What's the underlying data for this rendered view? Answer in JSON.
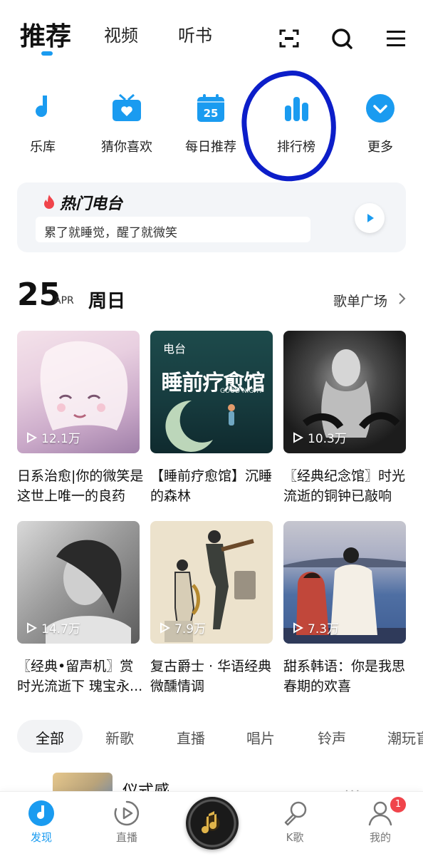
{
  "top_tabs": [
    "推荐",
    "视频",
    "听书"
  ],
  "quick_nav": [
    {
      "label": "乐库",
      "icon": "music-note-icon"
    },
    {
      "label": "猜你喜欢",
      "icon": "heart-radio-icon"
    },
    {
      "label": "每日推荐",
      "icon": "calendar-icon",
      "icon_text": "25"
    },
    {
      "label": "排行榜",
      "icon": "bar-chart-icon"
    },
    {
      "label": "更多",
      "icon": "chevron-down-icon"
    }
  ],
  "radio": {
    "title": "热门电台",
    "subtitle": "累了就睡觉，醒了就微笑"
  },
  "date": {
    "day": "25",
    "month": "APR",
    "weekday": "周日"
  },
  "playlist_link": "歌单广场",
  "cards": [
    {
      "plays": "12.1万",
      "title": "日系治愈|你的微笑是这世上唯一的良药"
    },
    {
      "plays": "",
      "badge": "电台",
      "cover_text": "睡前疗愈馆",
      "cover_sub": "GOOD NIGHT",
      "title": "【睡前疗愈馆】沉睡的森林"
    },
    {
      "plays": "10.3万",
      "title": "〖经典纪念馆〗时光流逝的铜钟已敲响"
    },
    {
      "plays": "14.7万",
      "title": "〖经典•留声机〗赏时光流逝下 瑰宝永..."
    },
    {
      "plays": "7.9万",
      "title": "复古爵士 · 华语经典微醺情调"
    },
    {
      "plays": "7.3万",
      "title": "甜系韩语：你是我思春期的欢喜"
    }
  ],
  "categories": [
    "全部",
    "新歌",
    "直播",
    "唱片",
    "铃声",
    "潮玩盲"
  ],
  "list_item": {
    "title": "仪式感",
    "more": "···"
  },
  "bottom_nav": [
    {
      "label": "发现",
      "icon": "discover-icon"
    },
    {
      "label": "直播",
      "icon": "live-play-icon"
    },
    {
      "label": "K歌",
      "icon": "microphone-icon"
    },
    {
      "label": "我的",
      "icon": "profile-icon",
      "badge": "1"
    }
  ],
  "colors": {
    "accent": "#1a9bf0",
    "annotation": "#0c1ec9",
    "badge": "#f0444b"
  }
}
